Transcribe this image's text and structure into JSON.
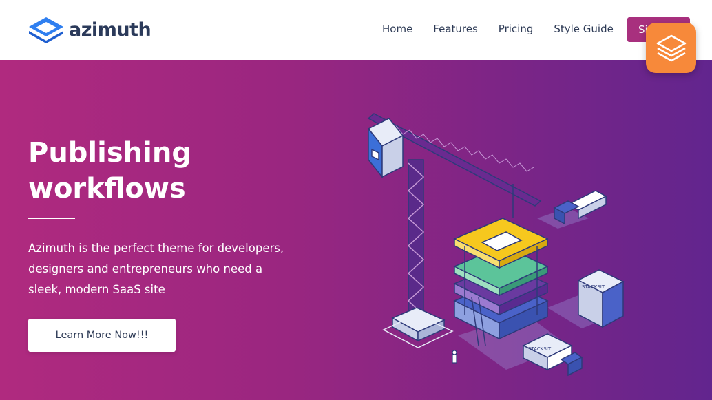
{
  "brand": {
    "name": "azimuth",
    "logo_icon": "azimuth-diamond-icon"
  },
  "nav": {
    "items": [
      {
        "label": "Home"
      },
      {
        "label": "Features"
      },
      {
        "label": "Pricing"
      },
      {
        "label": "Style Guide"
      }
    ],
    "signup_label": "Sign Up"
  },
  "badge": {
    "icon": "stack-layers-icon"
  },
  "hero": {
    "title_lines": [
      "Publishing",
      "workflows"
    ],
    "description_lines": [
      "Azimuth is the perfect theme for developers,",
      "designers and entrepreneurs who need a",
      "sleek, modern SaaS site"
    ],
    "cta_label": "Learn More Now!!!",
    "crate_labels": [
      "STACKSIT",
      "STACKSIT"
    ]
  },
  "colors": {
    "brand_blue": "#2f7ff0",
    "brand_text": "#2b3a5a",
    "button_magenta": "#a8307e",
    "badge_orange": "#f7893a",
    "hero_gradient_start": "#b02a7f",
    "hero_gradient_end": "#62258e"
  }
}
